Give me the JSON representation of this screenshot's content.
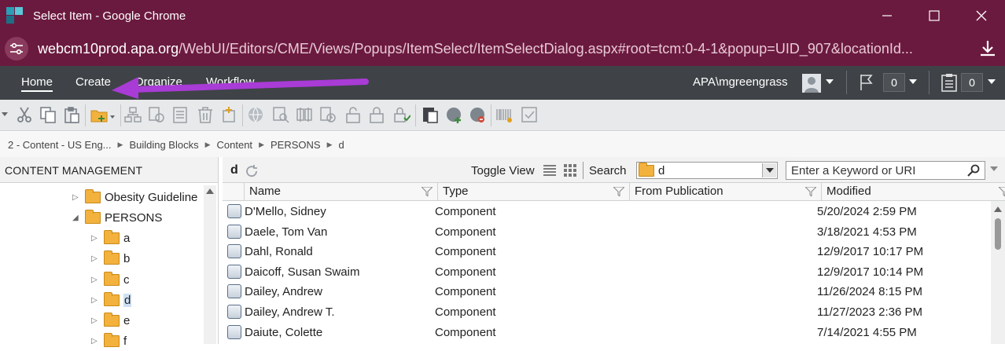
{
  "window": {
    "title": "Select Item - Google Chrome",
    "url_host": "webcm10prod.apa.org",
    "url_path": "/WebUI/Editors/CME/Views/Popups/ItemSelect/ItemSelectDialog.aspx#root=tcm:0-4-1&popup=UID_907&locationId..."
  },
  "menubar": {
    "tabs": [
      "Home",
      "Create",
      "Organize",
      "Workflow"
    ],
    "user": "APA\\mgreengrass",
    "flag_count": "0",
    "list_count": "0"
  },
  "breadcrumb": [
    "2 - Content - US Eng...",
    "Building Blocks",
    "Content",
    "PERSONS",
    "d"
  ],
  "left_panel": {
    "title": "CONTENT MANAGEMENT",
    "tree": [
      {
        "label": "Obesity Guideline",
        "expanded": false
      },
      {
        "label": "PERSONS",
        "expanded": true
      },
      {
        "label": "a"
      },
      {
        "label": "b"
      },
      {
        "label": "c"
      },
      {
        "label": "d",
        "selected": true
      },
      {
        "label": "e"
      },
      {
        "label": "f"
      }
    ]
  },
  "right_panel": {
    "folder": "d",
    "toggle_view_label": "Toggle View",
    "search_label": "Search",
    "search_location": "d",
    "keyword_placeholder": "Enter a Keyword or URI",
    "columns": [
      "Name",
      "Type",
      "From Publication",
      "Modified"
    ],
    "rows": [
      {
        "name": "D'Mello, Sidney",
        "type": "Component",
        "from": "",
        "modified": "5/20/2024 2:59 PM"
      },
      {
        "name": "Daele, Tom Van",
        "type": "Component",
        "from": "",
        "modified": "3/18/2021 4:53 PM"
      },
      {
        "name": "Dahl, Ronald",
        "type": "Component",
        "from": "",
        "modified": "12/9/2017 10:17 PM"
      },
      {
        "name": "Daicoff, Susan Swaim",
        "type": "Component",
        "from": "",
        "modified": "12/9/2017 10:14 PM"
      },
      {
        "name": "Dailey, Andrew",
        "type": "Component",
        "from": "",
        "modified": "11/26/2024 8:15 PM"
      },
      {
        "name": "Dailey, Andrew T.",
        "type": "Component",
        "from": "",
        "modified": "11/27/2023 2:36 PM"
      },
      {
        "name": "Daiute, Colette",
        "type": "Component",
        "from": "",
        "modified": "7/14/2021 4:55 PM"
      }
    ]
  },
  "colors": {
    "title_bar": "#6b1a3f",
    "menu_bar": "#3f4347",
    "annotation_arrow": "#a93bd6"
  }
}
